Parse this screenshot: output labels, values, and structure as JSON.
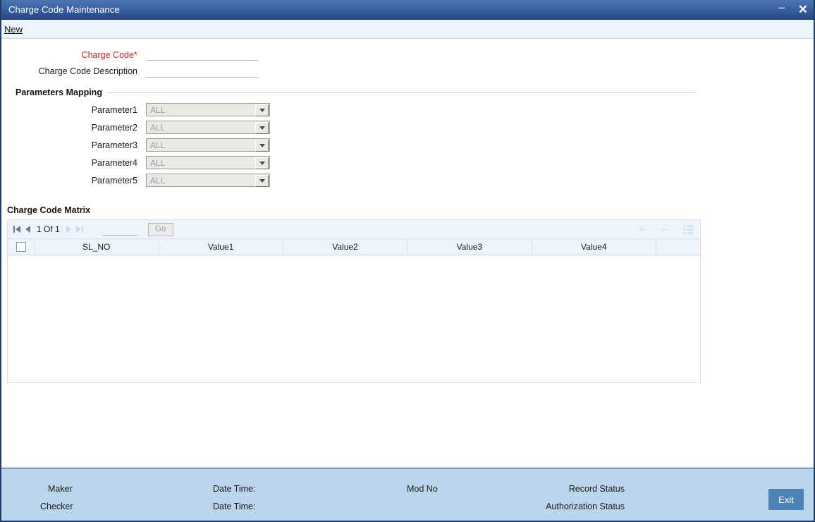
{
  "window": {
    "title": "Charge Code Maintenance",
    "minimize_icon": "minimize-icon",
    "close_icon": "close-icon",
    "minimize_glyph": "−",
    "close_glyph": "✕"
  },
  "menubar": {
    "new_label": "New"
  },
  "form": {
    "charge_code": {
      "label": "Charge Code",
      "required_marker": "*",
      "value": "",
      "placeholder": ""
    },
    "charge_code_description": {
      "label": "Charge Code Description",
      "value": "",
      "placeholder": ""
    }
  },
  "parameters_mapping": {
    "section_title": "Parameters Mapping",
    "rows": [
      {
        "label": "Parameter1",
        "value": "ALL"
      },
      {
        "label": "Parameter2",
        "value": "ALL"
      },
      {
        "label": "Parameter3",
        "value": "ALL"
      },
      {
        "label": "Parameter4",
        "value": "ALL"
      },
      {
        "label": "Parameter5",
        "value": "ALL"
      }
    ]
  },
  "charge_code_matrix": {
    "title": "Charge Code Matrix",
    "pager": {
      "first_icon": "first-page-icon",
      "prev_icon": "previous-page-icon",
      "text": "1 Of 1",
      "next_icon": "next-page-icon",
      "last_icon": "last-page-icon",
      "page_input_value": "",
      "go_label": "Go"
    },
    "actions": {
      "add_icon": "plus-icon",
      "add_glyph": "+",
      "remove_icon": "minus-icon",
      "remove_glyph": "−",
      "detail_icon": "list-detail-icon"
    },
    "columns": [
      "SL_NO",
      "Value1",
      "Value2",
      "Value3",
      "Value4"
    ],
    "rows": []
  },
  "footer": {
    "maker_label": "Maker",
    "checker_label": "Checker",
    "maker_datetime_label": "Date Time:",
    "checker_datetime_label": "Date Time:",
    "mod_no_label": "Mod No",
    "record_status_label": "Record Status",
    "authorization_status_label": "Authorization Status",
    "exit_label": "Exit"
  },
  "colors": {
    "titlebar_top": "#4a74b2",
    "titlebar_bottom": "#28477f",
    "required_red": "#c0282d",
    "footer_blue": "#bbd6ec",
    "exit_blue": "#4e82b4",
    "grid_header_blue": "#eef4fb",
    "window_border": "#1f3c66"
  }
}
